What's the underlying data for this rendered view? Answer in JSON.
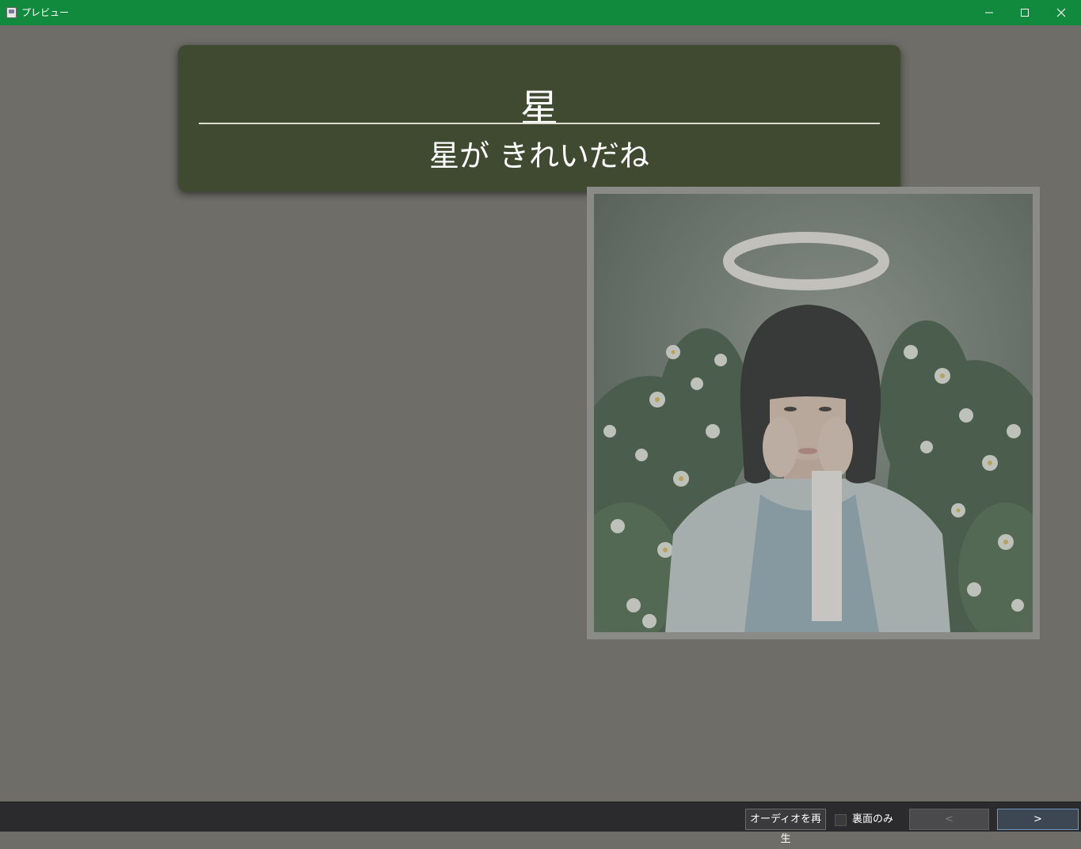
{
  "window": {
    "title": "プレビュー",
    "icon": "app-icon",
    "controls": [
      "minimize-icon",
      "maximize-icon",
      "close-icon"
    ]
  },
  "card": {
    "front": "星",
    "back": "星が きれいだね"
  },
  "image": {
    "content": "photo"
  },
  "toolbar": {
    "play_audio_label": "オーディオを再生",
    "back_only_label": "裏面のみ",
    "back_only_checked": false,
    "prev_label": "<",
    "next_label": ">"
  },
  "colors": {
    "titlebar": "#118a3e",
    "background": "#6e6d68",
    "card": "#3f4a30",
    "toolbar": "#2b2b2d",
    "next_button_border": "#6f94bd"
  }
}
